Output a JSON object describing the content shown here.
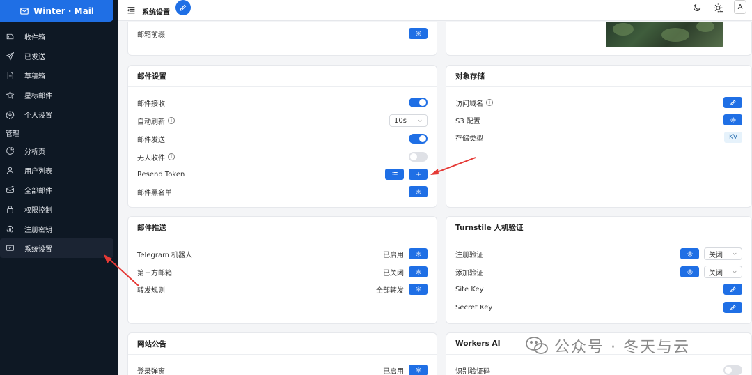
{
  "brand": {
    "name": "Winter · Mail"
  },
  "sidebar": {
    "items": [
      {
        "label": "收件箱",
        "icon": "inbox-icon"
      },
      {
        "label": "已发送",
        "icon": "send-icon"
      },
      {
        "label": "草稿箱",
        "icon": "draft-icon"
      },
      {
        "label": "星标邮件",
        "icon": "star-icon"
      },
      {
        "label": "个人设置",
        "icon": "gear-icon"
      }
    ],
    "group_label": "管理",
    "admin_items": [
      {
        "label": "分析页",
        "icon": "pie-chart-icon"
      },
      {
        "label": "用户列表",
        "icon": "user-icon"
      },
      {
        "label": "全部邮件",
        "icon": "mailbox-icon"
      },
      {
        "label": "权限控制",
        "icon": "lock-icon"
      },
      {
        "label": "注册密钥",
        "icon": "fingerprint-icon"
      },
      {
        "label": "系统设置",
        "icon": "monitor-settings-icon",
        "active": true
      }
    ]
  },
  "topbar": {
    "title": "系统设置",
    "avatar": "A"
  },
  "cards": {
    "prefix": {
      "label": "邮箱前缀"
    },
    "mail_settings": {
      "title": "邮件设置",
      "receive": "邮件接收",
      "auto_refresh": "自动刷新",
      "refresh_value": "10s",
      "send": "邮件发送",
      "no_recipient": "无人收件",
      "resend_token": "Resend Token",
      "blacklist": "邮件黑名单"
    },
    "storage": {
      "title": "对象存储",
      "domain": "访问域名",
      "s3": "S3 配置",
      "type": "存储类型",
      "type_value": "KV"
    },
    "push": {
      "title": "邮件推送",
      "telegram": "Telegram 机器人",
      "telegram_status": "已启用",
      "third_party": "第三方邮箱",
      "third_party_status": "已关闭",
      "forward": "转发规则",
      "forward_status": "全部转发"
    },
    "turnstile": {
      "title": "Turnstile 人机验证",
      "register": "注册验证",
      "register_value": "关闭",
      "add": "添加验证",
      "add_value": "关闭",
      "site_key": "Site Key",
      "secret_key": "Secret Key"
    },
    "notice": {
      "title": "网站公告",
      "popup": "登录弹窗",
      "popup_status": "已启用"
    },
    "ai": {
      "title": "Workers AI",
      "captcha": "识别验证码"
    }
  },
  "watermark": "公众号 · 冬天与云",
  "colors": {
    "accent": "#1f6fe5",
    "sidebar_bg": "#0e1824",
    "arrow": "#e53935"
  }
}
